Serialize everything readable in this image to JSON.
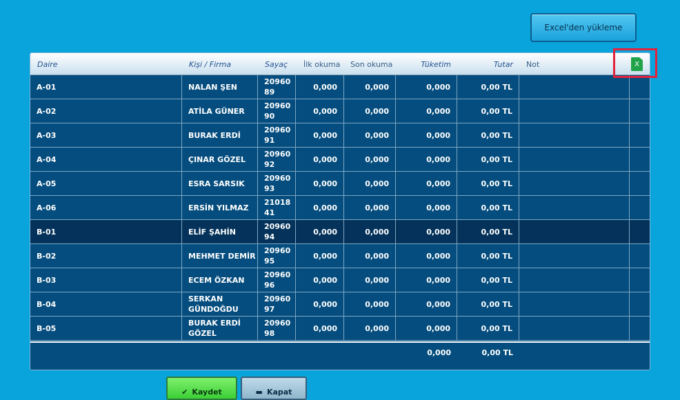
{
  "toolbar": {
    "excel_upload_label": "Excel'den yükleme"
  },
  "table": {
    "headers": {
      "daire": "Daire",
      "kisi": "Kişi / Firma",
      "sayac": "Sayaç",
      "ilk": "İlk okuma",
      "son": "Son okuma",
      "tuketim": "Tüketim",
      "tutar": "Tutar",
      "not": "Not"
    },
    "excel_icon_glyph": "X",
    "rows": [
      {
        "daire": "A-01",
        "kisi_line1": "NALAN ŞEN",
        "kisi_line2": "",
        "sayac_line1": "20960",
        "sayac_line2": "89",
        "ilk": "0,000",
        "son": "0,000",
        "tuketim": "0,000",
        "tutar": "0,00 TL",
        "not": ""
      },
      {
        "daire": "A-02",
        "kisi_line1": "ATİLA GÜNER",
        "kisi_line2": "",
        "sayac_line1": "20960",
        "sayac_line2": "90",
        "ilk": "0,000",
        "son": "0,000",
        "tuketim": "0,000",
        "tutar": "0,00 TL",
        "not": ""
      },
      {
        "daire": "A-03",
        "kisi_line1": "BURAK ERDİ",
        "kisi_line2": "",
        "sayac_line1": "20960",
        "sayac_line2": "91",
        "ilk": "0,000",
        "son": "0,000",
        "tuketim": "0,000",
        "tutar": "0,00 TL",
        "not": ""
      },
      {
        "daire": "A-04",
        "kisi_line1": "ÇINAR GÖZEL",
        "kisi_line2": "",
        "sayac_line1": "20960",
        "sayac_line2": "92",
        "ilk": "0,000",
        "son": "0,000",
        "tuketim": "0,000",
        "tutar": "0,00 TL",
        "not": ""
      },
      {
        "daire": "A-05",
        "kisi_line1": "ESRA SARSIK",
        "kisi_line2": "",
        "sayac_line1": "20960",
        "sayac_line2": "93",
        "ilk": "0,000",
        "son": "0,000",
        "tuketim": "0,000",
        "tutar": "0,00 TL",
        "not": ""
      },
      {
        "daire": "A-06",
        "kisi_line1": "ERSİN YILMAZ",
        "kisi_line2": "",
        "sayac_line1": "21018",
        "sayac_line2": "41",
        "ilk": "0,000",
        "son": "0,000",
        "tuketim": "0,000",
        "tutar": "0,00 TL",
        "not": ""
      },
      {
        "daire": "B-01",
        "kisi_line1": "ELİF ŞAHİN",
        "kisi_line2": "",
        "sayac_line1": "20960",
        "sayac_line2": "94",
        "ilk": "0,000",
        "son": "0,000",
        "tuketim": "0,000",
        "tutar": "0,00 TL",
        "not": ""
      },
      {
        "daire": "B-02",
        "kisi_line1": "MEHMET DEMİR",
        "kisi_line2": "",
        "sayac_line1": "20960",
        "sayac_line2": "95",
        "ilk": "0,000",
        "son": "0,000",
        "tuketim": "0,000",
        "tutar": "0,00 TL",
        "not": ""
      },
      {
        "daire": "B-03",
        "kisi_line1": "ECEM ÖZKAN",
        "kisi_line2": "",
        "sayac_line1": "20960",
        "sayac_line2": "96",
        "ilk": "0,000",
        "son": "0,000",
        "tuketim": "0,000",
        "tutar": "0,00 TL",
        "not": ""
      },
      {
        "daire": "B-04",
        "kisi_line1": "SERKAN",
        "kisi_line2": "GÜNDOĞDU",
        "sayac_line1": "20960",
        "sayac_line2": "97",
        "ilk": "0,000",
        "son": "0,000",
        "tuketim": "0,000",
        "tutar": "0,00 TL",
        "not": ""
      },
      {
        "daire": "B-05",
        "kisi_line1": "BURAK ERDİ",
        "kisi_line2": "GÖZEL",
        "sayac_line1": "20960",
        "sayac_line2": "98",
        "ilk": "0,000",
        "son": "0,000",
        "tuketim": "0,000",
        "tutar": "0,00 TL",
        "not": ""
      }
    ],
    "selected_row": "B-01",
    "totals": {
      "tuketim": "0,000",
      "tutar": "0,00 TL"
    }
  },
  "footer": {
    "save_label": "Kaydet",
    "close_label": "Kapat"
  },
  "colors": {
    "background": "#0aa4dc",
    "grid": "#054d7e",
    "selected_row": "#04325a",
    "highlight": "#e3233b",
    "save": "#3ccf36"
  }
}
